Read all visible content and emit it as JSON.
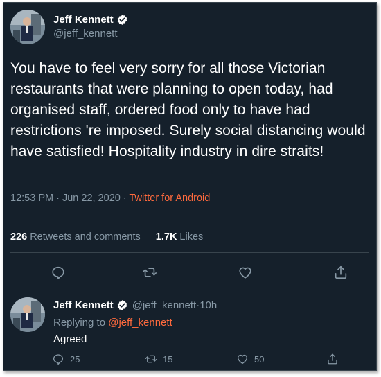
{
  "tweet": {
    "display_name": "Jeff Kennett",
    "handle": "@jeff_kennett",
    "text": "You have to feel very sorry for all those Victorian restaurants that were planning to open today, had organised staff, ordered food only to have had restrictions 're imposed. Surely social distancing would have satisfied! Hospitality industry in dire straits!",
    "time": "12:53 PM",
    "separator": " · ",
    "date": "Jun 22, 2020",
    "source": "Twitter for Android",
    "retweets_count": "226",
    "retweets_label": "Retweets and comments",
    "likes_count": "1.7K",
    "likes_label": "Likes"
  },
  "reply": {
    "display_name": "Jeff Kennett",
    "handle": "@jeff_kennett",
    "separator": " · ",
    "age": "10h",
    "replying_prefix": "Replying to ",
    "replying_to": "@jeff_kennett",
    "text": "Agreed",
    "comments": "25",
    "retweets": "15",
    "likes": "50"
  },
  "colors": {
    "background": "#15202b",
    "border": "#38444d",
    "secondary_text": "#8899a6",
    "accent": "#ff6a3d",
    "verified_badge": "#ffffff"
  },
  "icons": {
    "comment": "comment-icon",
    "retweet": "retweet-icon",
    "like": "heart-icon",
    "share": "share-icon",
    "verified": "verified-badge-icon"
  }
}
